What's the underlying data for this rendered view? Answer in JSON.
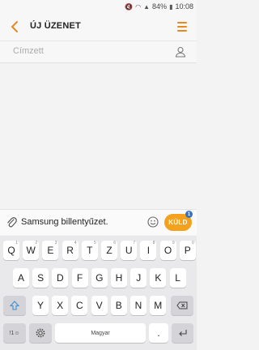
{
  "status_bar": {
    "battery": "84%",
    "time": "10:08"
  },
  "header": {
    "title": "ÚJ ÜZENET"
  },
  "recipient": {
    "placeholder": "Címzett"
  },
  "composer": {
    "message_text": "Samsung billentyűzet.",
    "send_label": "KÜLD",
    "send_badge": "1"
  },
  "keyboard": {
    "row1": [
      {
        "label": "Q",
        "hint": "1"
      },
      {
        "label": "W",
        "hint": "2"
      },
      {
        "label": "E",
        "hint": "3"
      },
      {
        "label": "R",
        "hint": "4"
      },
      {
        "label": "T",
        "hint": "5"
      },
      {
        "label": "Z",
        "hint": "6"
      },
      {
        "label": "U",
        "hint": "7"
      },
      {
        "label": "I",
        "hint": "8"
      },
      {
        "label": "O",
        "hint": "9"
      },
      {
        "label": "P",
        "hint": "0"
      }
    ],
    "row2": [
      "A",
      "S",
      "D",
      "F",
      "G",
      "H",
      "J",
      "K",
      "L"
    ],
    "row3": [
      "Y",
      "X",
      "C",
      "V",
      "B",
      "N",
      "M"
    ],
    "symbols_label": "!1☺",
    "space_label": "Magyar",
    "period_label": ".",
    "settings_hint": "⚙",
    "comma_label": ","
  },
  "colors": {
    "accent": "#f4a11e",
    "badge": "#3b71c5",
    "header_icon": "#e8891f"
  }
}
